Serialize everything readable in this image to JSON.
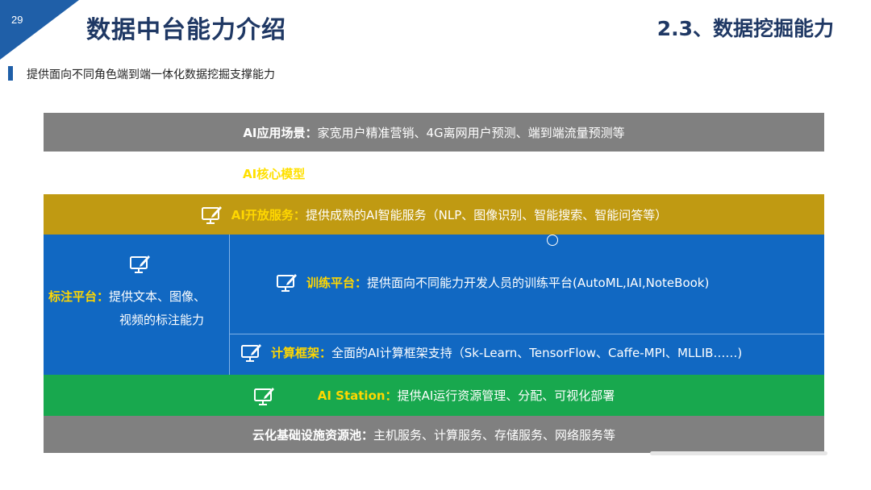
{
  "page_number": "29",
  "title": "数据中台能力介绍",
  "section": "2.3、数据挖掘能力",
  "subtitle": "提供面向不同角色端到端一体化数据挖掘支撑能力",
  "scene": {
    "label": "AI应用场景：",
    "text": "家宽用户精准营销、4G离网用户预测、端到端流量预测等"
  },
  "core_model": "AI核心模型",
  "open_service": {
    "label": "AI开放服务：",
    "text": "提供成熟的AI智能服务（NLP、图像识别、智能搜索、智能问答等）"
  },
  "labeling": {
    "label": "标注平台：",
    "line1": "提供文本、图像、",
    "line2": "视频的标注能力"
  },
  "training": {
    "label": "训练平台：",
    "text": "提供面向不同能力开发人员的训练平台(AutoML,IAI,NoteBook)"
  },
  "framework": {
    "label": "计算框架：",
    "text": "全面的AI计算框架支持（Sk-Learn、TensorFlow、Caffe-MPI、MLLIB……)"
  },
  "station": {
    "label": "AI Station：",
    "text": "提供AI运行资源管理、分配、可视化部署"
  },
  "cloud": {
    "label": "云化基础设施资源池：",
    "text": "主机服务、计算服务、存储服务、网络服务等"
  },
  "colors": {
    "title": "#1f3864",
    "gray": "#808080",
    "gold": "#c09a12",
    "blue": "#1168c2",
    "green": "#18a84e",
    "highlight": "#ffd700"
  },
  "icons": [
    "monitor-edit-icon"
  ]
}
